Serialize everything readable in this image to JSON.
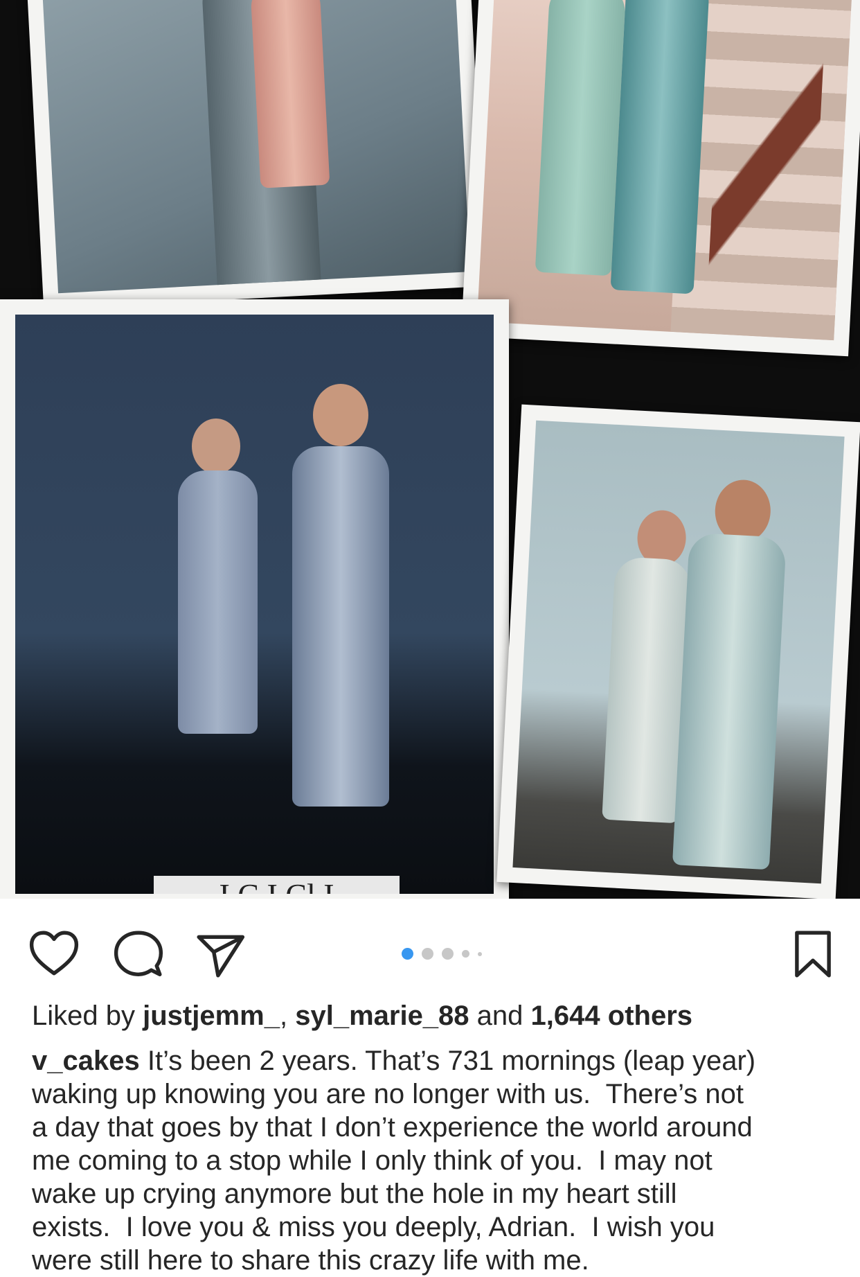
{
  "post": {
    "carousel": {
      "total": 5,
      "active_index": 0
    },
    "photo_sign_text": "I C I Cl I",
    "actions": {
      "like_icon": "heart-outline-icon",
      "comment_icon": "comment-bubble-icon",
      "share_icon": "paper-plane-icon",
      "save_icon": "bookmark-outline-icon",
      "active_dot_color": "#3897f0",
      "inactive_dot_color": "#c7c7c7"
    },
    "likes": {
      "prefix": "Liked by",
      "user1": "justjemm_",
      "separator": ",",
      "user2": "syl_marie_88",
      "and_text": "and",
      "others": "1,644 others"
    },
    "caption": {
      "username": "v_cakes",
      "text": "It’s been 2 years. That’s 731 mornings (leap year)\nwaking up knowing you are no longer with us.  There’s not\na day that goes by that I don’t experience the world around\nme coming to a stop while I only think of you.  I may not\nwake up crying anymore but the hole in my heart still\nexists.  I love you & miss you deeply, Adrian.  I wish you\nwere still here to share this crazy life with me."
    }
  }
}
